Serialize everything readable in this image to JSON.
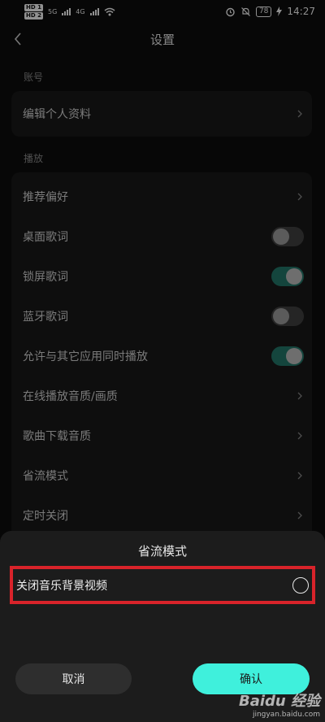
{
  "status_bar": {
    "hd1": "HD 1",
    "hd2": "HD 2",
    "net1": "5G",
    "net2": "4G",
    "battery": "78",
    "time": "14:27"
  },
  "header": {
    "title": "设置"
  },
  "sections": {
    "account_label": "账号",
    "playback_label": "播放"
  },
  "account_items": [
    {
      "label": "编辑个人资料"
    }
  ],
  "playback_items": [
    {
      "label": "推荐偏好",
      "control": "chevron"
    },
    {
      "label": "桌面歌词",
      "control": "toggle",
      "on": false
    },
    {
      "label": "锁屏歌词",
      "control": "toggle",
      "on": true
    },
    {
      "label": "蓝牙歌词",
      "control": "toggle",
      "on": false
    },
    {
      "label": "允许与其它应用同时播放",
      "control": "toggle",
      "on": true
    },
    {
      "label": "在线播放音质/画质",
      "control": "chevron"
    },
    {
      "label": "歌曲下载音质",
      "control": "chevron"
    },
    {
      "label": "省流模式",
      "control": "chevron"
    },
    {
      "label": "定时关闭",
      "control": "chevron"
    }
  ],
  "sheet": {
    "title": "省流模式",
    "option_label": "关闭音乐背景视频",
    "option_selected": false,
    "cancel_label": "取消",
    "confirm_label": "确认"
  },
  "watermark": {
    "main": "Baidu 经验",
    "sub": "jingyan.baidu.com"
  },
  "colors": {
    "accent": "#3ff0dc",
    "toggle_on": "#1f6b5f",
    "highlight": "#d8232a"
  }
}
